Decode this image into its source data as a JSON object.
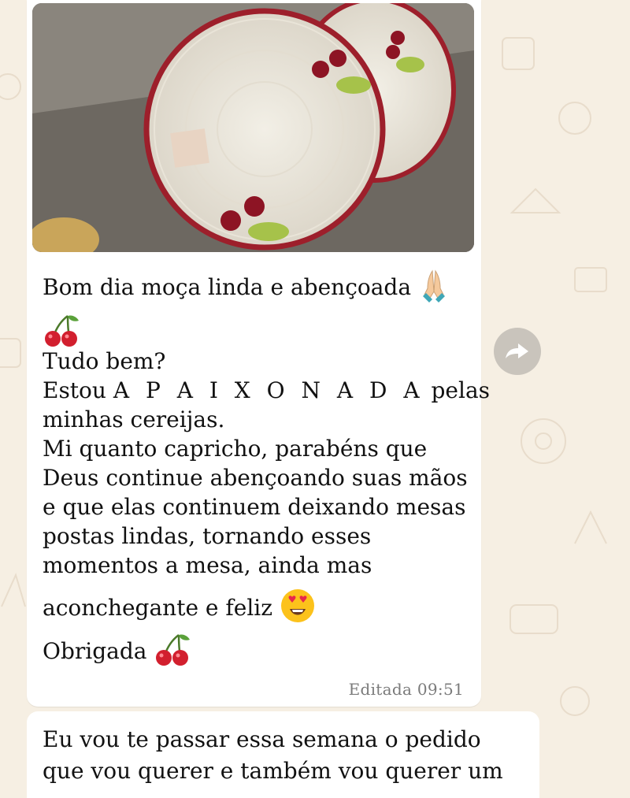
{
  "message": {
    "image": {
      "description_icon": "crochet-placemat-photo-icon"
    },
    "lines": {
      "l1": "Bom dia moça linda e abençoada",
      "l3": "Tudo bem?",
      "l4a": "Estou",
      "l4b": "A P A I X O N A D A",
      "l4c": "pelas",
      "l5": "minhas cereijas.",
      "l6": "Mi quanto capricho, parabéns que",
      "l7": "Deus continue abençoando suas mãos",
      "l8": "e que elas continuem deixando mesas",
      "l9": "postas lindas, tornando esses",
      "l10": "momentos a mesa, ainda mas",
      "l11": "aconchegante e feliz",
      "l12": "Obrigada"
    },
    "emojis": {
      "pray": "pray-hands-icon",
      "cherries": "cherries-icon",
      "heart_eyes": "heart-eyes-face-icon"
    },
    "meta": "Editada 09:51"
  },
  "forward_button": {
    "icon": "forward-icon"
  },
  "next_message": {
    "line1": "Eu vou te passar essa semana o pedido",
    "line2": "que vou querer e também vou querer um"
  },
  "colors": {
    "background": "#f6efe3",
    "bubble": "#ffffff",
    "meta_text": "#7b7b7b"
  }
}
